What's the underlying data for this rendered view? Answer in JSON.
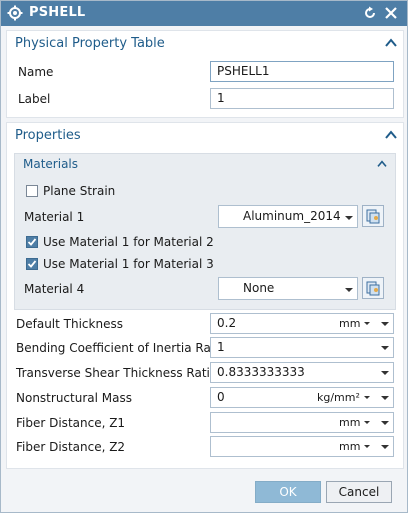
{
  "window": {
    "title": "PSHELL"
  },
  "physical_property_table": {
    "header": "Physical Property Table",
    "name_label": "Name",
    "name_value": "PSHELL1",
    "label_label": "Label",
    "label_value": "1"
  },
  "properties": {
    "header": "Properties",
    "materials": {
      "header": "Materials",
      "plane_strain_label": "Plane Strain",
      "plane_strain_checked": false,
      "material1_label": "Material 1",
      "material1_value": "Aluminum_2014",
      "use_m1_for_m2_label": "Use Material 1 for Material 2",
      "use_m1_for_m2_checked": true,
      "use_m1_for_m3_label": "Use Material 1 for Material 3",
      "use_m1_for_m3_checked": true,
      "material4_label": "Material 4",
      "material4_value": "None"
    },
    "default_thickness": {
      "label": "Default Thickness",
      "value": "0.2",
      "unit": "mm"
    },
    "bending_coefficient": {
      "label": "Bending Coefficient of Inertia Ratio",
      "value": "1"
    },
    "transverse_shear": {
      "label": "Transverse Shear Thickness Ratio",
      "value": "0.8333333333"
    },
    "nonstructural_mass": {
      "label": "Nonstructural Mass",
      "value": "0",
      "unit": "kg/mm²"
    },
    "fiber_distance_z1": {
      "label": "Fiber Distance, Z1",
      "value": "",
      "unit": "mm"
    },
    "fiber_distance_z2": {
      "label": "Fiber Distance, Z2",
      "value": "",
      "unit": "mm"
    }
  },
  "buttons": {
    "ok": "OK",
    "cancel": "Cancel"
  },
  "colors": {
    "titlebar": "#4e7ea6",
    "section_header": "#1f5c8a",
    "ok_button": "#8fb9d6"
  }
}
